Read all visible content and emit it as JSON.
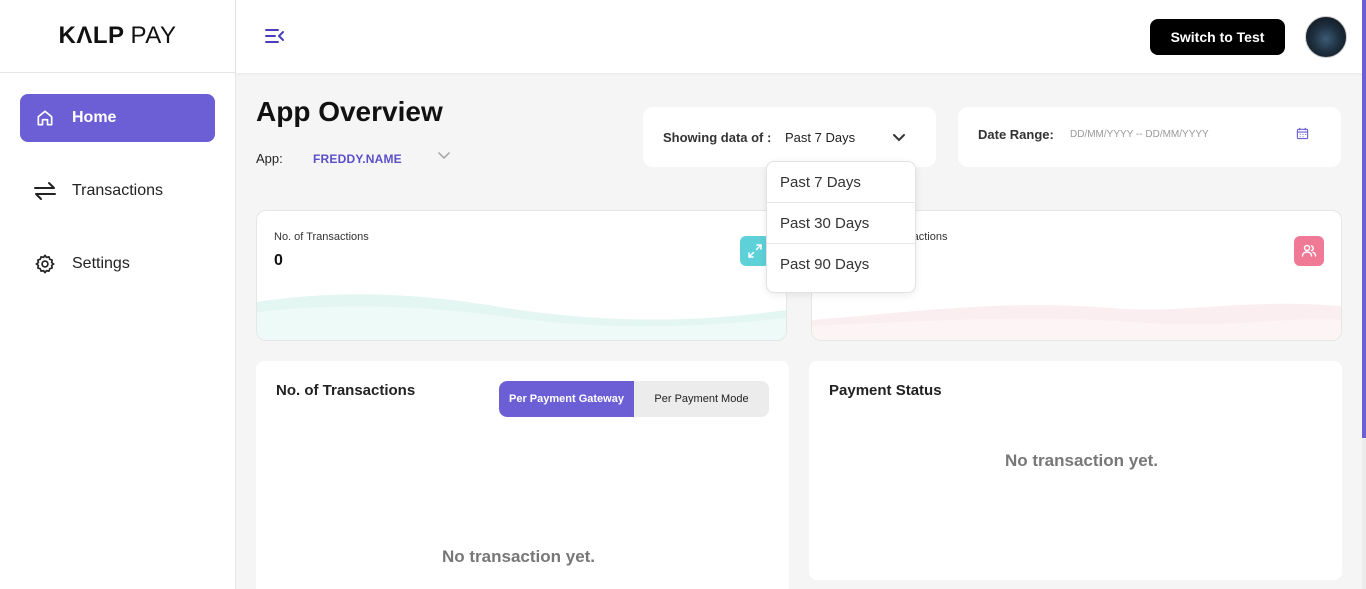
{
  "logo": {
    "bold": "KɅLP",
    "light": "PAY"
  },
  "sidebar": {
    "items": [
      {
        "label": "Home"
      },
      {
        "label": "Transactions"
      },
      {
        "label": "Settings"
      }
    ]
  },
  "topbar": {
    "switch_label": "Switch to Test"
  },
  "main": {
    "title": "App Overview",
    "app_label": "App:",
    "app_value": "FREDDY.NAME",
    "showing_label": "Showing data of :",
    "showing_value": "Past 7 Days",
    "date_range_label": "Date Range:",
    "date_range_placeholder": "DD/MM/YYYY -- DD/MM/YYYY"
  },
  "dropdown": {
    "options": [
      "Past 7 Days",
      "Past 30 Days",
      "Past 90 Days"
    ]
  },
  "stats": [
    {
      "title": "No. of Transactions",
      "value": "0",
      "icon": "expand-arrows-icon",
      "color": "#4fd1d9"
    },
    {
      "title": "nsactions",
      "icon": "users-icon",
      "color": "#f07a96"
    }
  ],
  "panels": {
    "transactions": {
      "title": "No. of Transactions",
      "toggle": [
        "Per Payment Gateway",
        "Per Payment Mode"
      ],
      "empty": "No transaction yet."
    },
    "payment_status": {
      "title": "Payment Status",
      "empty": "No transaction yet."
    }
  },
  "colors": {
    "accent": "#6c5fd6",
    "button_dark": "#000000"
  }
}
